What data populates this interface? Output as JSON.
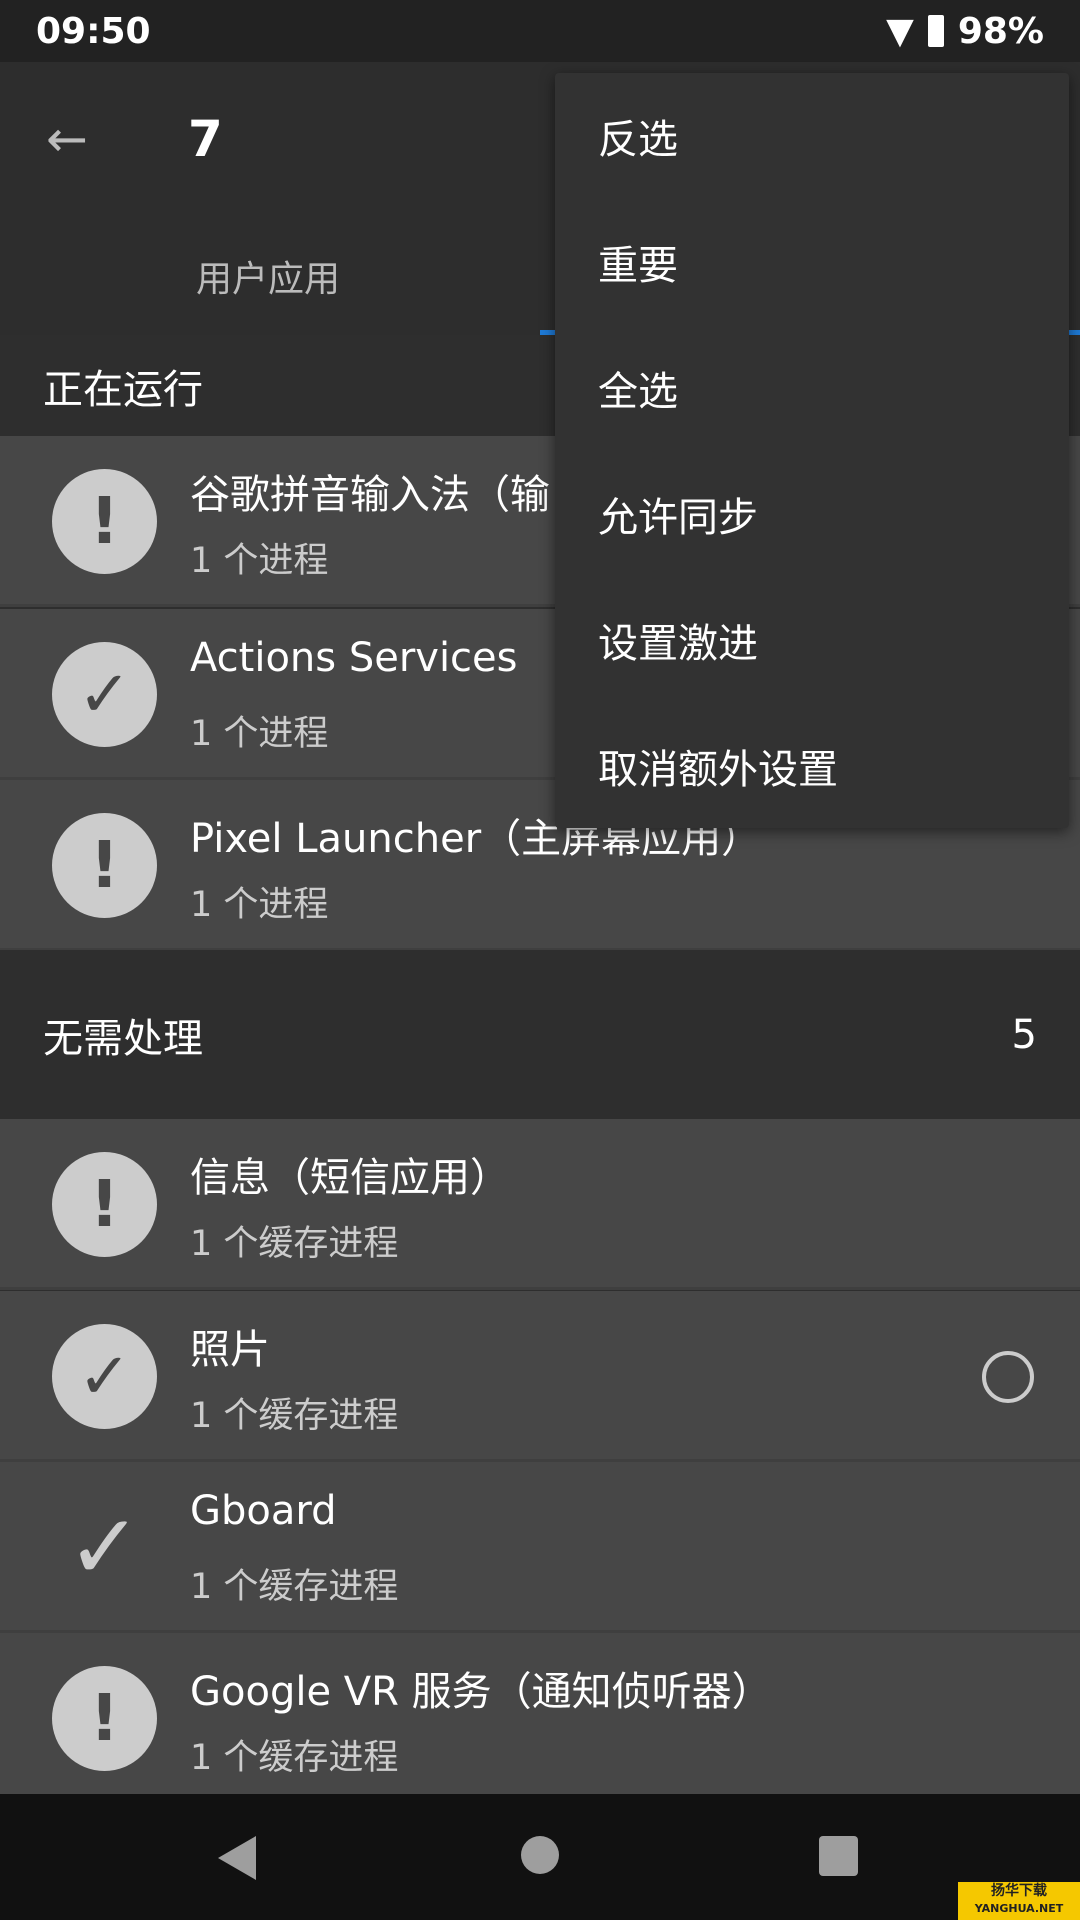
{
  "status": {
    "time": "09:50",
    "battery": "98%"
  },
  "toolbar": {
    "title": "7",
    "tab": "用户应用"
  },
  "sections": [
    {
      "title": "正在运行",
      "count": "",
      "rows": [
        {
          "name": "谷歌拼音输入法（输",
          "sub": "1 个进程",
          "icon": "exclamation-icon"
        },
        {
          "name": "Actions Services",
          "sub": "1 个进程",
          "icon": "check-circle-icon"
        },
        {
          "name": "Pixel Launcher（主屏幕应用）",
          "sub": "1 个进程",
          "icon": "exclamation-icon"
        }
      ]
    },
    {
      "title": "无需处理",
      "count": "5",
      "rows": [
        {
          "name": "信息（短信应用）",
          "sub": "1 个缓存进程",
          "icon": "exclamation-icon"
        },
        {
          "name": "照片",
          "sub": "1 个缓存进程",
          "icon": "check-circle-icon"
        },
        {
          "name": "Gboard",
          "sub": "1 个缓存进程",
          "icon": "check-icon"
        },
        {
          "name": "Google VR 服务（通知侦听器）",
          "sub": "1 个缓存进程",
          "icon": "exclamation-icon"
        }
      ]
    }
  ],
  "menu": [
    "反选",
    "重要",
    "全选",
    "允许同步",
    "设置激进",
    "取消额外设置"
  ],
  "watermark": {
    "cn": "扬华下载",
    "en": "YANGHUA.NET"
  },
  "colors": {
    "accent": "#1e7ad6",
    "row": "#474747",
    "header": "#2e2e2e",
    "menu": "#323232"
  }
}
